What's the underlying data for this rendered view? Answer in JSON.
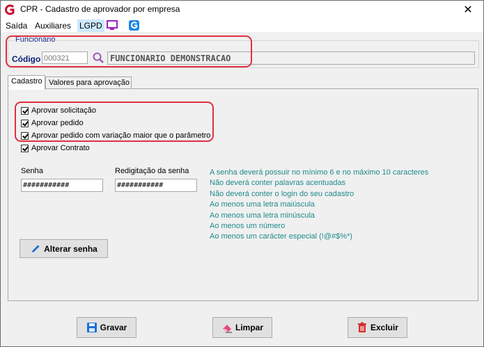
{
  "window": {
    "title": "CPR - Cadastro de aprovador por empresa",
    "close_glyph": "✕"
  },
  "menu": {
    "items": [
      "Saída",
      "Auxiliares",
      "LGPD"
    ],
    "icons": [
      "monitor-icon",
      "g-app-icon"
    ]
  },
  "funcionario": {
    "legend": "Funcionário",
    "codigo_label": "Código",
    "codigo_value": "000321",
    "nome": "FUNCIONARIO DEMONSTRACAO"
  },
  "tabs": [
    "Cadastro",
    "Valores para aprovação"
  ],
  "checkboxes": [
    {
      "label": "Aprovar solicitação",
      "checked": true
    },
    {
      "label": "Aprovar pedido",
      "checked": true
    },
    {
      "label": "Aprovar pedido com variação maior que o parâmetro",
      "checked": true
    },
    {
      "label": "Aprovar Contrato",
      "checked": true
    }
  ],
  "senha": {
    "label": "Senha",
    "value": "###########"
  },
  "redigitacao": {
    "label": "Redigitação da senha",
    "value": "###########"
  },
  "rules": [
    "A senha deverá possuir no mínimo 6 e no máximo 10 caracteres",
    "Não deverá conter palavras acentuadas",
    "Não deverá conter o login do seu cadastro",
    "Ao menos uma letra maiúscula",
    "Ao menos uma letra minúscula",
    "Ao menos um número",
    "Ao menos um carácter especial (!@#$%*)"
  ],
  "buttons": {
    "alterar": "Alterar senha",
    "gravar": "Gravar",
    "limpar": "Limpar",
    "excluir": "Excluir"
  },
  "colors": {
    "accent_red": "#e03040",
    "rule_text": "#1f8a8a",
    "label_blue": "#0b1f7a"
  }
}
